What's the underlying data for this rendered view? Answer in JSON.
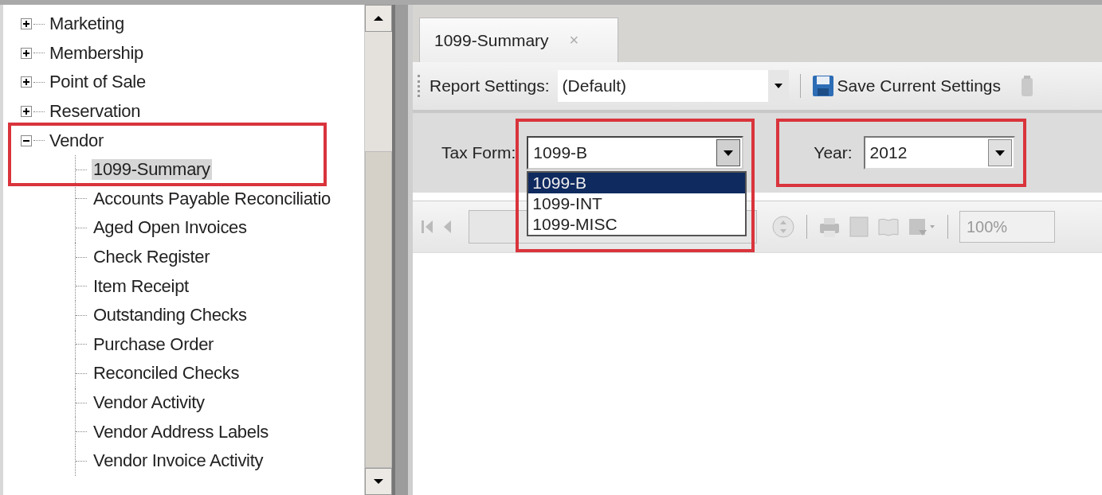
{
  "tree": {
    "nodes": [
      {
        "label": "Marketing",
        "expanded": false,
        "selected": false,
        "highlighted": false
      },
      {
        "label": "Membership",
        "expanded": false,
        "selected": false,
        "highlighted": false
      },
      {
        "label": "Point of Sale",
        "expanded": false,
        "selected": false,
        "highlighted": false
      },
      {
        "label": "Reservation",
        "expanded": false,
        "selected": false,
        "highlighted": false
      },
      {
        "label": "Vendor",
        "expanded": true,
        "selected": false,
        "highlighted": true,
        "children": [
          {
            "label": "1099-Summary",
            "selected": true
          },
          {
            "label": "Accounts Payable Reconciliatio",
            "selected": false
          },
          {
            "label": "Aged Open Invoices",
            "selected": false
          },
          {
            "label": "Check Register",
            "selected": false
          },
          {
            "label": "Item Receipt",
            "selected": false
          },
          {
            "label": "Outstanding Checks",
            "selected": false
          },
          {
            "label": "Purchase Order",
            "selected": false
          },
          {
            "label": "Reconciled Checks",
            "selected": false
          },
          {
            "label": "Vendor Activity",
            "selected": false
          },
          {
            "label": "Vendor Address Labels",
            "selected": false
          },
          {
            "label": "Vendor Invoice Activity",
            "selected": false
          }
        ]
      }
    ]
  },
  "tabs": [
    {
      "label": "1099-Summary",
      "close": "×",
      "selected": true
    }
  ],
  "toolbar": {
    "settings_label": "Report Settings:",
    "settings_value": "(Default)",
    "save_button": "Save Current Settings"
  },
  "parameters": [
    {
      "label": "Tax Form:",
      "value": "1099-B",
      "highlighted": true,
      "open": true,
      "options": [
        {
          "label": "1099-B",
          "selected": true
        },
        {
          "label": "1099-INT",
          "selected": false
        },
        {
          "label": "1099-MISC",
          "selected": false
        }
      ]
    },
    {
      "label": "Year:",
      "value": "2012",
      "highlighted": true,
      "open": false
    }
  ],
  "viewer": {
    "zoom": "100%"
  }
}
